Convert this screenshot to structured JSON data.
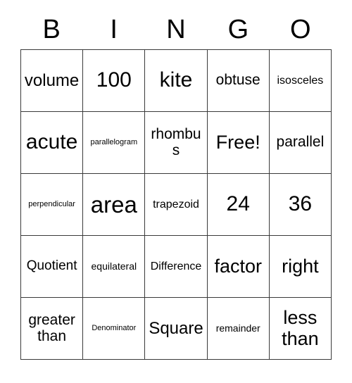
{
  "card": {
    "title_letters": [
      "B",
      "I",
      "N",
      "G",
      "O"
    ],
    "free_space_label": "Free!",
    "rows": [
      [
        {
          "text": "volume",
          "size": "fs-2xl"
        },
        {
          "text": "100",
          "size": "fs-4xl"
        },
        {
          "text": "kite",
          "size": "fs-4xl"
        },
        {
          "text": "obtuse",
          "size": "fs-xl"
        },
        {
          "text": "isosceles",
          "size": "fs-md"
        }
      ],
      [
        {
          "text": "acute",
          "size": "fs-4xl"
        },
        {
          "text": "parallelogram",
          "size": "fs-xs"
        },
        {
          "text": "rhombus",
          "size": "fs-xl"
        },
        {
          "text": "Free!",
          "size": "fs-3xl"
        },
        {
          "text": "parallel",
          "size": "fs-xl"
        }
      ],
      [
        {
          "text": "perpendicular",
          "size": "fs-xs"
        },
        {
          "text": "area",
          "size": "fs-5xl"
        },
        {
          "text": "trapezoid",
          "size": "fs-md"
        },
        {
          "text": "24",
          "size": "fs-4xl"
        },
        {
          "text": "36",
          "size": "fs-4xl"
        }
      ],
      [
        {
          "text": "Quotient",
          "size": "fs-lg"
        },
        {
          "text": "equilateral",
          "size": "fs-sm"
        },
        {
          "text": "Difference",
          "size": "fs-md"
        },
        {
          "text": "factor",
          "size": "fs-3xl"
        },
        {
          "text": "right",
          "size": "fs-3xl"
        }
      ],
      [
        {
          "text": "greater than",
          "size": "fs-xl"
        },
        {
          "text": "Denominator",
          "size": "fs-xs"
        },
        {
          "text": "Square",
          "size": "fs-2xl"
        },
        {
          "text": "remainder",
          "size": "fs-sm"
        },
        {
          "text": "less than",
          "size": "fs-3xl"
        }
      ]
    ]
  },
  "colors": {
    "background": "#ffffff",
    "border": "#3a3a3a",
    "text": "#000000"
  }
}
